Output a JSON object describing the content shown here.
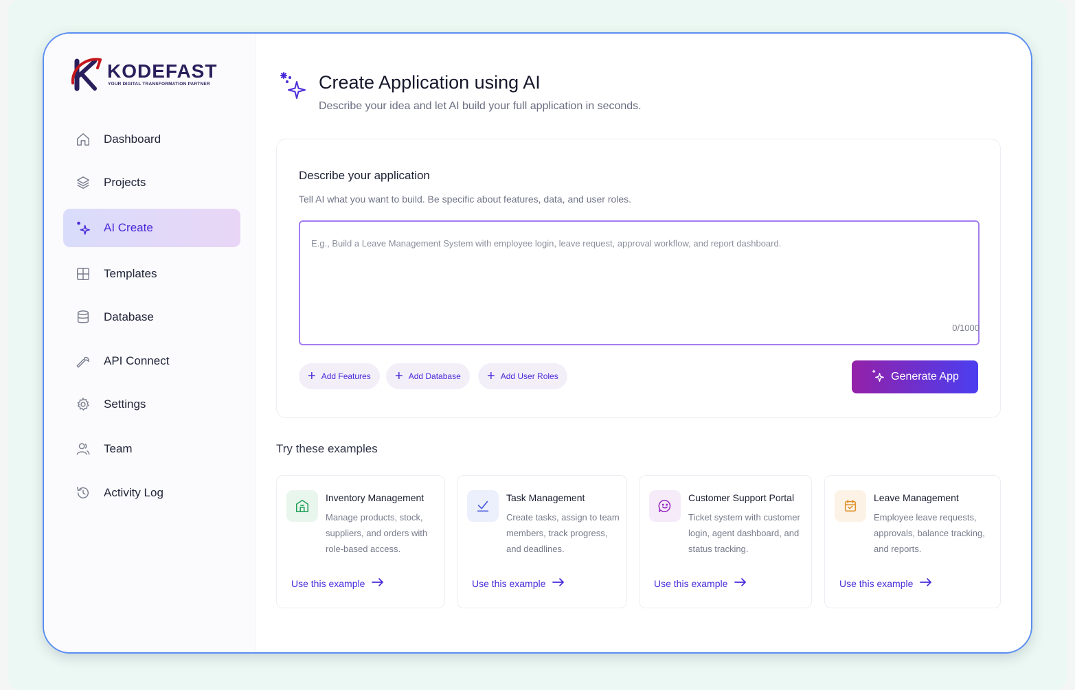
{
  "brand": {
    "name": "KODEFAST",
    "tagline": "YOUR DIGITAL TRANSFORMATION PARTNER",
    "colors": {
      "logo_red": "#c4161c",
      "logo_navy": "#2a1f5c"
    }
  },
  "sidebar": {
    "items": [
      {
        "label": "Dashboard",
        "icon": "home-icon",
        "active": false
      },
      {
        "label": "Projects",
        "icon": "layers-icon",
        "active": false
      },
      {
        "label": "AI Create",
        "icon": "sparkle-icon",
        "active": true
      },
      {
        "label": "Templates",
        "icon": "grid-icon",
        "active": false
      },
      {
        "label": "Database",
        "icon": "database-icon",
        "active": false
      },
      {
        "label": "API Connect",
        "icon": "wrench-icon",
        "active": false
      },
      {
        "label": "Settings",
        "icon": "gear-icon",
        "active": false
      },
      {
        "label": "Team",
        "icon": "user-icon",
        "active": false
      },
      {
        "label": "Activity Log",
        "icon": "history-icon",
        "active": false
      }
    ]
  },
  "header": {
    "title": "Create Application using AI",
    "subtitle": "Describe your idea and let AI build your full application in seconds."
  },
  "form": {
    "title": "Describe your application",
    "subtitle": "Tell AI what you want to build. Be specific about features, data, and user roles.",
    "textarea": {
      "value": "",
      "placeholder": "E.g., Build a Leave Management System with employee login, leave request, approval workflow, and report dashboard."
    },
    "counter": "0/1000",
    "chips": [
      {
        "label": "Add Features"
      },
      {
        "label": "Add Database"
      },
      {
        "label": "Add User Roles"
      }
    ],
    "generate_label": "Generate App"
  },
  "examples": {
    "title": "Try these examples",
    "link_label": "Use this example",
    "items": [
      {
        "name": "Inventory Management",
        "desc": "Manage products, stock, suppliers, and orders with role-based access.",
        "icon": "package-icon",
        "color": "#22a05a"
      },
      {
        "name": "Task Management",
        "desc": "Create tasks, assign to team members, track progress, and deadlines.",
        "icon": "check-icon",
        "color": "#4a5cd9"
      },
      {
        "name": "Customer Support Portal",
        "desc": "Ticket system with customer login, agent dashboard, and status tracking.",
        "icon": "chat-icon",
        "color": "#9a2bc4"
      },
      {
        "name": "Leave Management",
        "desc": "Employee leave requests, approvals, balance tracking, and reports.",
        "icon": "calendar-icon",
        "color": "#e0902a"
      }
    ]
  },
  "colors": {
    "accent": "#4a2ad9",
    "frame_border": "#5b8ef0",
    "generate_gradient_start": "#9321a8",
    "generate_gradient_end": "#4b3ef0"
  }
}
